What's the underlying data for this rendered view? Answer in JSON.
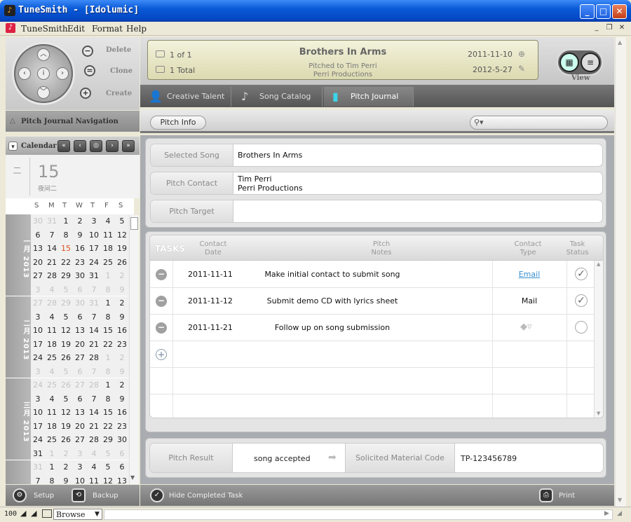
{
  "window": {
    "title": "TuneSmith - [Idolumic]",
    "min": "_",
    "max": "□",
    "close": "✕"
  },
  "menu": [
    "TuneSmith",
    "Edit",
    "Format",
    "Help"
  ],
  "actions": {
    "delete": "Delete",
    "clone": "Clone",
    "create": "Create",
    "delete_sym": "−",
    "clone_sym": "=",
    "create_sym": "+"
  },
  "nav_header": "Pitch Journal Navigation",
  "calendar": {
    "label": "Calendar",
    "today_day": "15",
    "today_weekday": "二",
    "today_sub": "夜间二",
    "weekday_header": [
      "S",
      "M",
      "T",
      "W",
      "T",
      "F",
      "S"
    ],
    "months": [
      {
        "label": "一月 2013",
        "rows": [
          [
            "30",
            "31",
            "1",
            "2",
            "3",
            "4",
            "5"
          ],
          [
            "6",
            "7",
            "8",
            "9",
            "10",
            "11",
            "12"
          ],
          [
            "13",
            "14",
            "15",
            "16",
            "17",
            "18",
            "19"
          ],
          [
            "20",
            "21",
            "22",
            "23",
            "24",
            "25",
            "26"
          ],
          [
            "27",
            "28",
            "29",
            "30",
            "31",
            "1",
            "2"
          ],
          [
            "3",
            "4",
            "5",
            "6",
            "7",
            "8",
            "9"
          ]
        ]
      },
      {
        "label": "二月 2013",
        "rows": [
          [
            "27",
            "28",
            "29",
            "30",
            "31",
            "1",
            "2"
          ],
          [
            "3",
            "4",
            "5",
            "6",
            "7",
            "8",
            "9"
          ],
          [
            "10",
            "11",
            "12",
            "13",
            "14",
            "15",
            "16"
          ],
          [
            "17",
            "18",
            "19",
            "20",
            "21",
            "22",
            "23"
          ],
          [
            "24",
            "25",
            "26",
            "27",
            "28",
            "1",
            "2"
          ],
          [
            "3",
            "4",
            "5",
            "6",
            "7",
            "8",
            "9"
          ]
        ]
      },
      {
        "label": "三月 2013",
        "rows": [
          [
            "24",
            "25",
            "26",
            "27",
            "28",
            "1",
            "2"
          ],
          [
            "3",
            "4",
            "5",
            "6",
            "7",
            "8",
            "9"
          ],
          [
            "10",
            "11",
            "12",
            "13",
            "14",
            "15",
            "16"
          ],
          [
            "17",
            "18",
            "19",
            "20",
            "21",
            "22",
            "23"
          ],
          [
            "24",
            "25",
            "26",
            "27",
            "28",
            "29",
            "30"
          ],
          [
            "31",
            "1",
            "2",
            "3",
            "4",
            "5",
            "6"
          ]
        ]
      },
      {
        "label": "",
        "rows": [
          [
            "31",
            "1",
            "2",
            "3",
            "4",
            "5",
            "6"
          ],
          [
            "7",
            "8",
            "9",
            "10",
            "11",
            "12",
            "13"
          ]
        ]
      }
    ]
  },
  "bottom_left": {
    "setup": "Setup",
    "backup": "Backup"
  },
  "record": {
    "position": "1 of 1",
    "total": "1 Total",
    "title": "Brothers In Arms",
    "pitched_to": "Pitched to Tim Perri",
    "company": "Perri Productions",
    "date_created": "2011-11-10",
    "date_modified": "2012-5-27"
  },
  "view_label": "View",
  "tabs": [
    "Creative Talent",
    "Song Catalog",
    "Pitch Journal"
  ],
  "pitch_info_button": "Pitch Info",
  "search_placeholder": "",
  "fields": {
    "selected_song_label": "Selected Song",
    "selected_song": "Brothers In Arms",
    "pitch_contact_label": "Pitch Contact",
    "pitch_contact_line1": "Tim Perri",
    "pitch_contact_line2": "Perri Productions",
    "pitch_target_label": "Pitch Target",
    "pitch_target": ""
  },
  "tasks": {
    "title": "TASKS",
    "col_contact": "Contact",
    "col_date": "Date",
    "col_pitch": "Pitch",
    "col_notes": "Notes",
    "col_ctype1": "Contact",
    "col_ctype2": "Type",
    "col_status1": "Task",
    "col_status2": "Status",
    "rows": [
      {
        "date": "2011-11-11",
        "note": "Make initial contact to submit song",
        "type": "Email",
        "done": "✓"
      },
      {
        "date": "2011-11-12",
        "note": "Submit demo CD with lyrics sheet",
        "type": "Mail",
        "done": "✓"
      },
      {
        "date": "2011-11-21",
        "note": "Follow up on song submission",
        "type": "",
        "done": ""
      }
    ]
  },
  "result": {
    "pitch_result_label": "Pitch Result",
    "pitch_result": "song accepted",
    "material_label": "Solicited Material Code",
    "material_code": "TP-123456789"
  },
  "bottom_right": {
    "hide_completed": "Hide Completed Task",
    "print": "Print"
  },
  "status": {
    "zoom": "100",
    "mode": "Browse"
  }
}
